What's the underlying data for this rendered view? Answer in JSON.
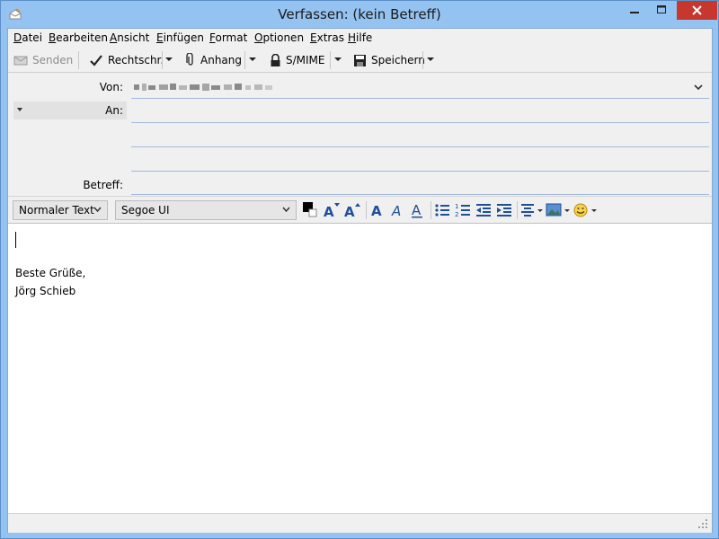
{
  "window": {
    "title": "Verfassen: (kein Betreff)"
  },
  "menu": {
    "items": [
      {
        "key": "D",
        "rest": "atei"
      },
      {
        "key": "B",
        "rest": "earbeiten"
      },
      {
        "key": "A",
        "rest": "nsicht"
      },
      {
        "key": "E",
        "rest": "infügen"
      },
      {
        "key": "F",
        "rest": "ormat"
      },
      {
        "key": "O",
        "rest": "ptionen"
      },
      {
        "key": "E",
        "rest": "xtras"
      },
      {
        "key": "H",
        "rest": "ilfe"
      }
    ]
  },
  "toolbar": {
    "send_label": "Senden",
    "spell_label": "Rechtschr.",
    "attach_label": "Anhang",
    "smime_label": "S/MIME",
    "save_label": "Speichern"
  },
  "header": {
    "from_label": "Von:",
    "to_label": "An:",
    "subject_label": "Betreff:"
  },
  "format": {
    "paragraph_style": "Normaler Text",
    "font": "Segoe UI"
  },
  "body": {
    "signature_line1": "Beste Grüße,",
    "signature_line2": "Jörg Schieb"
  },
  "colors": {
    "accent": "#1f4e9c",
    "close_button": "#c7372d"
  }
}
